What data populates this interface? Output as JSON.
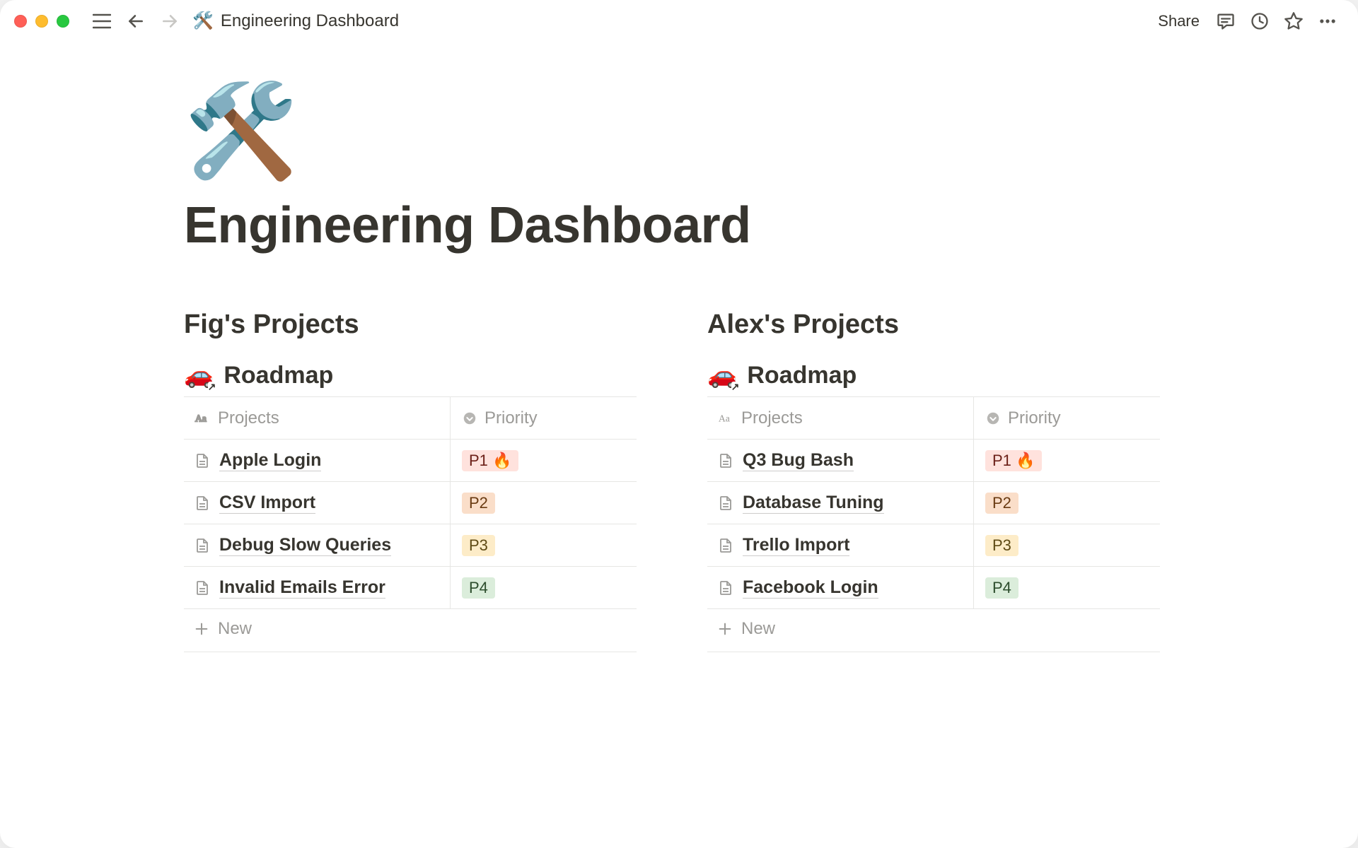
{
  "header": {
    "breadcrumb_emoji": "🛠️",
    "breadcrumb_title": "Engineering Dashboard",
    "share_label": "Share"
  },
  "page": {
    "icon": "🛠️",
    "title": "Engineering Dashboard"
  },
  "columns": [
    {
      "heading": "Fig's Projects",
      "db_emoji": "🚗",
      "db_name": "Roadmap",
      "col_projects": "Projects",
      "col_priority": "Priority",
      "new_label": "New",
      "rows": [
        {
          "name": "Apple Login",
          "priority": "P1 🔥",
          "priority_class": "p1"
        },
        {
          "name": "CSV Import",
          "priority": "P2",
          "priority_class": "p2"
        },
        {
          "name": "Debug Slow Queries",
          "priority": "P3",
          "priority_class": "p3"
        },
        {
          "name": "Invalid Emails Error",
          "priority": "P4",
          "priority_class": "p4"
        }
      ]
    },
    {
      "heading": "Alex's Projects",
      "db_emoji": "🚗",
      "db_name": "Roadmap",
      "col_projects": "Projects",
      "col_priority": "Priority",
      "new_label": "New",
      "rows": [
        {
          "name": "Q3 Bug Bash",
          "priority": "P1 🔥",
          "priority_class": "p1"
        },
        {
          "name": "Database Tuning",
          "priority": "P2",
          "priority_class": "p2"
        },
        {
          "name": "Trello Import",
          "priority": "P3",
          "priority_class": "p3"
        },
        {
          "name": "Facebook Login",
          "priority": "P4",
          "priority_class": "p4"
        }
      ]
    }
  ]
}
